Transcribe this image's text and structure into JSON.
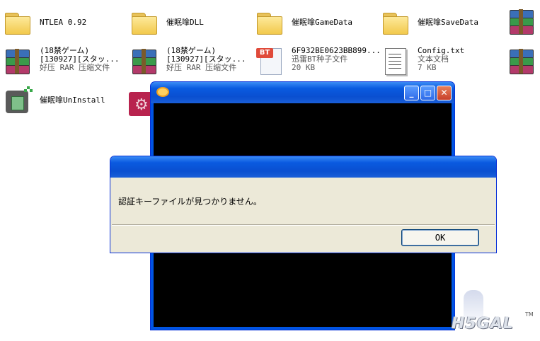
{
  "desktop": {
    "items": [
      {
        "name": "NTLEA 0.92",
        "type": "folder"
      },
      {
        "name": "催眠嗱DLL",
        "type": "folder"
      },
      {
        "name": "催眠嗱GameData",
        "type": "folder"
      },
      {
        "name": "催眠嗱SaveData",
        "type": "folder"
      },
      {
        "name": "(18禁ゲーム)",
        "line2": "[130927][スタッ...",
        "line3": "好压 RAR 压缩文件",
        "type": "rar"
      },
      {
        "name": "(18禁ゲーム)",
        "line2": "[130927][スタッ...",
        "line3": "好压 RAR 压缩文件",
        "type": "rar"
      },
      {
        "name": "6F932BE0623BB899...",
        "line2": "迅雷BT种子文件",
        "line3": "20 KB",
        "type": "bt"
      },
      {
        "name": "Config.txt",
        "line2": "文本文档",
        "line3": "7 KB",
        "type": "txt"
      },
      {
        "name": "催眠嗱UnInstall",
        "type": "uninstall"
      }
    ],
    "bt_icon_text": "BT"
  },
  "console_window": {
    "minimize_glyph": "_",
    "maximize_glyph": "□",
    "close_glyph": "✕"
  },
  "dialog": {
    "message": "認証キーファイルが見つかりません。",
    "ok_label": "OK"
  },
  "watermark": {
    "text": "H5GAL",
    "tm": "TM"
  }
}
